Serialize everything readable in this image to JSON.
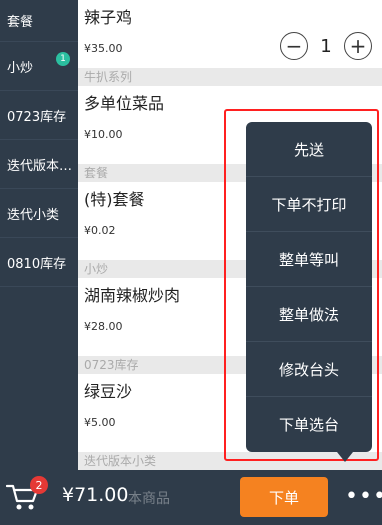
{
  "sidebar": {
    "items": [
      {
        "label": "套餐"
      },
      {
        "label": "小炒",
        "badge": "1"
      },
      {
        "label": "0723库存"
      },
      {
        "label": "迭代版本…"
      },
      {
        "label": "迭代小类"
      },
      {
        "label": "0810库存"
      }
    ]
  },
  "main": {
    "dishes": [
      {
        "name": "辣子鸡",
        "price": "¥35.00",
        "qty": "1"
      },
      {
        "section": "牛扒系列",
        "name": "多单位菜品",
        "price": "¥10.00"
      },
      {
        "section": "套餐",
        "name": "(特)套餐",
        "price": "¥0.02"
      },
      {
        "section": "小炒",
        "name": "湖南辣椒炒肉",
        "price": "¥28.00"
      },
      {
        "section": "0723库存",
        "name": "绿豆沙",
        "price": "¥5.00"
      }
    ],
    "last_section": "迭代版本小类"
  },
  "stepper": {
    "minus": "−",
    "plus": "+"
  },
  "popup_menu": {
    "items": [
      "先送",
      "下单不打印",
      "整单等叫",
      "整单做法",
      "修改台头",
      "下单选台"
    ]
  },
  "bottom_bar": {
    "cart_badge": "2",
    "total": "¥71.00",
    "ghost_text": "本商品",
    "order_label": "下单",
    "more_label": "•••"
  },
  "colors": {
    "sidebar_bg": "#2f3c4a",
    "accent_orange": "#f58220",
    "badge_green": "#2bbfa0",
    "badge_red": "#e53935",
    "highlight_red": "#ff2020"
  }
}
